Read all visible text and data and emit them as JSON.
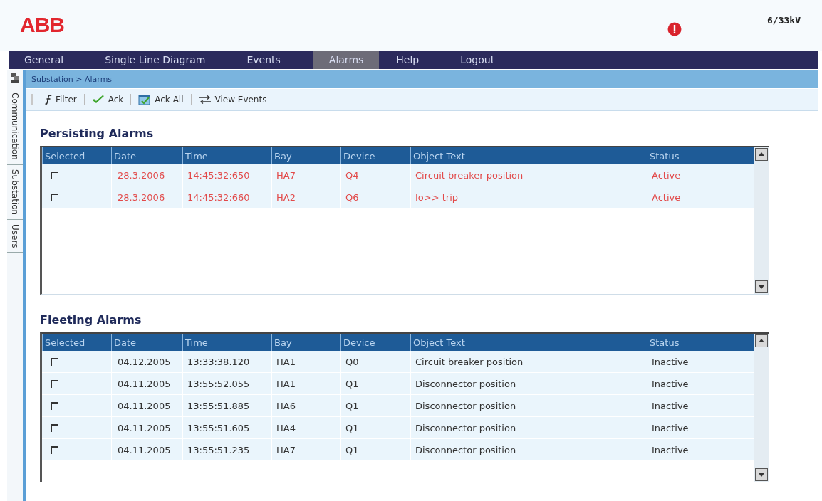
{
  "header": {
    "logo": "ABB",
    "voltage": "6/33kV"
  },
  "nav": [
    {
      "label": "General",
      "selected": false
    },
    {
      "label": "Single Line Diagram",
      "selected": false
    },
    {
      "label": "Events",
      "selected": false
    },
    {
      "label": "Alarms",
      "selected": true
    },
    {
      "label": "Help",
      "selected": false
    },
    {
      "label": "Logout",
      "selected": false
    }
  ],
  "side_tabs": [
    "Communication",
    "Substation",
    "Users"
  ],
  "breadcrumb": "Substation > Alarms",
  "toolbar": [
    {
      "kind": "filter",
      "label": "Filter"
    },
    {
      "kind": "ack",
      "label": "Ack"
    },
    {
      "kind": "ackall",
      "label": "Ack All"
    },
    {
      "kind": "events",
      "label": "View Events"
    }
  ],
  "tables": [
    {
      "title": "Persisting Alarms",
      "columns": [
        "Selected",
        "Date",
        "Time",
        "Bay",
        "Device",
        "Object Text",
        "Status"
      ],
      "rows": [
        {
          "checked": false,
          "active": true,
          "cells": [
            "",
            "28.3.2006",
            "14:45:32:650",
            "HA7",
            "Q4",
            "Circuit breaker position",
            "Active"
          ]
        },
        {
          "checked": false,
          "active": true,
          "cells": [
            "",
            "28.3.2006",
            "14:45:32:660",
            "HA2",
            "Q6",
            "Io>> trip",
            "Active"
          ]
        }
      ]
    },
    {
      "title": "Fleeting Alarms",
      "columns": [
        "Selected",
        "Date",
        "Time",
        "Bay",
        "Device",
        "Object Text",
        "Status"
      ],
      "rows": [
        {
          "checked": false,
          "active": false,
          "cells": [
            "",
            "04.12.2005",
            "13:33:38.120",
            "HA1",
            "Q0",
            "Circuit breaker position",
            "Inactive"
          ]
        },
        {
          "checked": false,
          "active": false,
          "cells": [
            "",
            "04.11.2005",
            "13:55:52.055",
            "HA1",
            "Q1",
            "Disconnector position",
            "Inactive"
          ]
        },
        {
          "checked": false,
          "active": false,
          "cells": [
            "",
            "04.11.2005",
            "13:55:51.885",
            "HA6",
            "Q1",
            "Disconnector position",
            "Inactive"
          ]
        },
        {
          "checked": false,
          "active": false,
          "cells": [
            "",
            "04.11.2005",
            "13:55:51.605",
            "HA4",
            "Q1",
            "Disconnector position",
            "Inactive"
          ]
        },
        {
          "checked": false,
          "active": false,
          "cells": [
            "",
            "04.11.2005",
            "13:55:51.235",
            "HA7",
            "Q1",
            "Disconnector position",
            "Inactive"
          ]
        }
      ]
    }
  ]
}
